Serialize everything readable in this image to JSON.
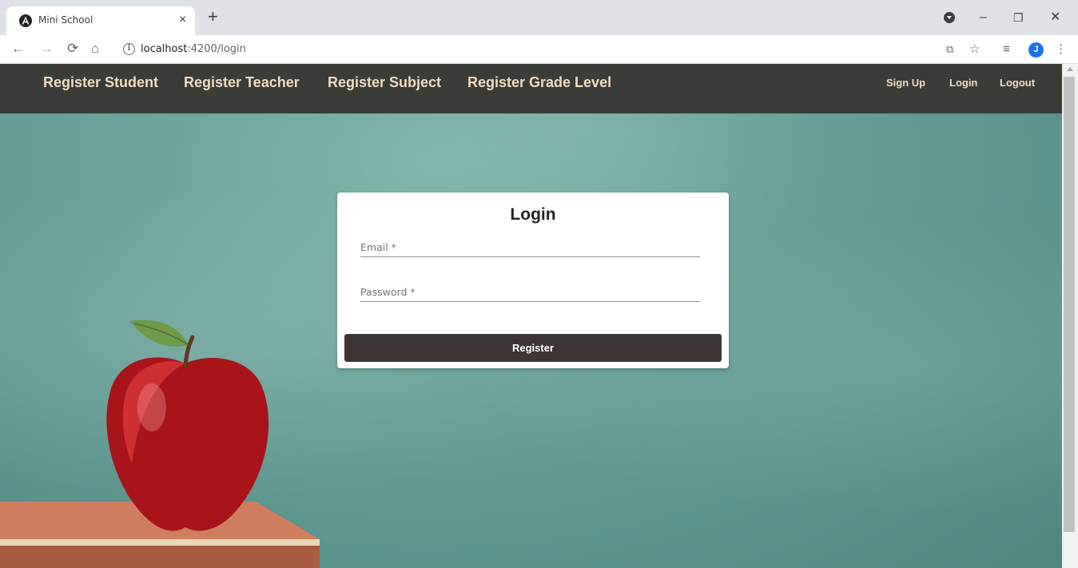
{
  "browser": {
    "tab_title": "Mini School",
    "tab_close": "×",
    "new_tab": "+",
    "url_host": "localhost",
    "url_rest": ":4200/login",
    "window_minimize": "–",
    "window_restore": "❐",
    "window_close": "✕",
    "avatar_letter": "J",
    "icons": [
      "back-arrow-icon",
      "forward-arrow-icon",
      "reload-icon",
      "home-icon",
      "info-icon",
      "translate-icon",
      "star-icon",
      "reading-list-icon",
      "profile-avatar",
      "menu-icon"
    ]
  },
  "navbar": {
    "links": [
      "Register Student",
      "Register Teacher",
      "Register Subject",
      "Register Grade Level"
    ],
    "right_links": [
      "Sign Up",
      "Login",
      "Logout"
    ],
    "background": "#3a3c38",
    "link_color": "#f3dcbf"
  },
  "login_form": {
    "title": "Login",
    "email_label": "Email *",
    "password_label": "Password *",
    "submit_label": "Register",
    "button_color": "#3d3634"
  },
  "background": {
    "chalkboard_color": "#6aa39b"
  }
}
